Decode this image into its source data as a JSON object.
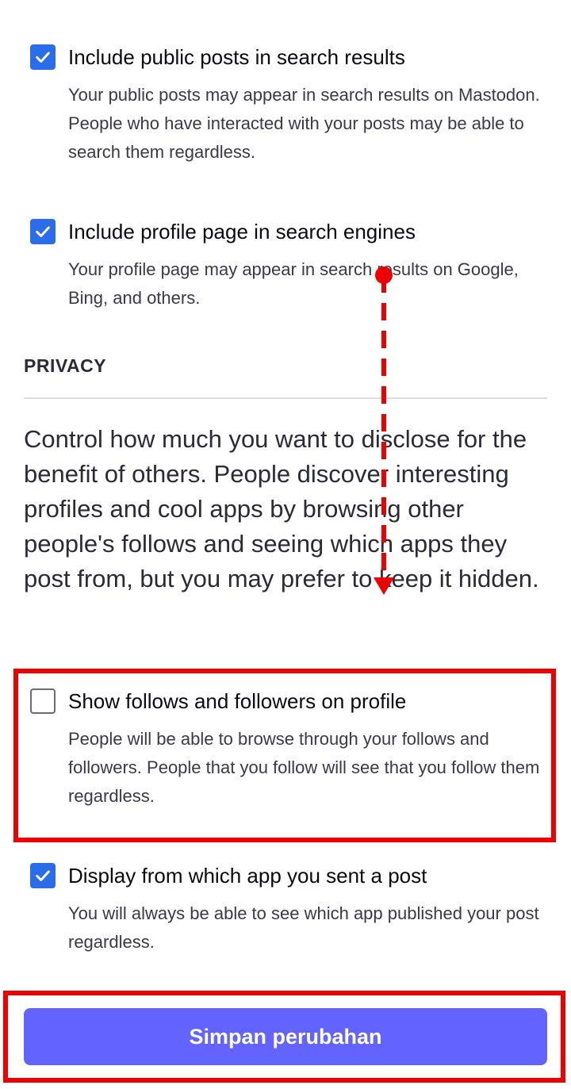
{
  "options": [
    {
      "label": "Include public posts in search results",
      "description": "Your public posts may appear in search results on Mastodon. People who have interacted with your posts may be able to search them regardless.",
      "checked": true
    },
    {
      "label": "Include profile page in search engines",
      "description": "Your profile page may appear in search results on Google, Bing, and others.",
      "checked": true
    },
    {
      "label": "Show follows and followers on profile",
      "description": "People will be able to browse through your follows and followers. People that you follow will see that you follow them regardless.",
      "checked": false
    },
    {
      "label": "Display from which app you sent a post",
      "description": "You will always be able to see which app published your post regardless.",
      "checked": true
    }
  ],
  "privacy": {
    "title": "PRIVACY",
    "description": "Control how much you want to disclose for the benefit of others. People discover interesting profiles and cool apps by browsing other people's follows and seeing which apps they post from, but you may prefer to keep it hidden."
  },
  "save_button": {
    "label": "Simpan perubahan"
  },
  "colors": {
    "accent": "#6364ff",
    "checkbox": "#2b6de8",
    "highlight": "#ee0000"
  },
  "icons": {
    "checked": "checkmark-icon",
    "unchecked": "empty-checkbox-icon"
  }
}
